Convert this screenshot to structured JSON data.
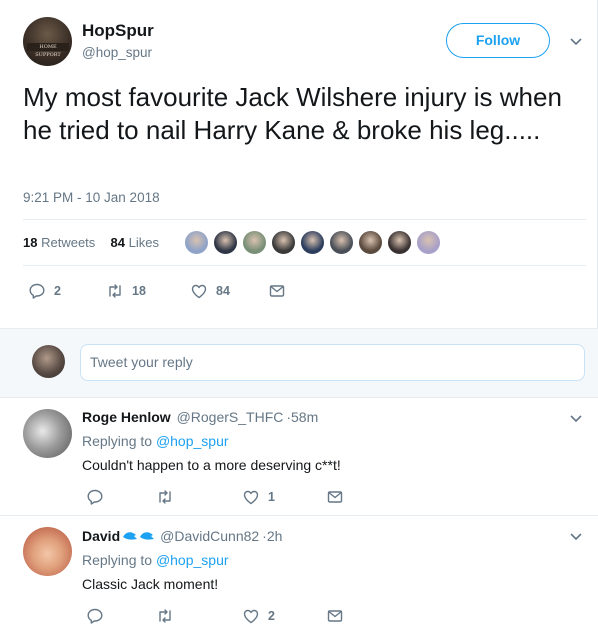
{
  "tweet": {
    "name": "HopSpur",
    "handle": "@hop_spur",
    "follow_label": "Follow",
    "avatar_caption": "HOME SUPPORT",
    "text": "My most favourite Jack Wilshere injury is when he tried to nail Harry Kane & broke his leg.....",
    "timestamp": "9:21 PM - 10 Jan 2018",
    "retweets_count": "18",
    "retweets_label": "Retweets",
    "likes_count": "84",
    "likes_label": "Likes",
    "liker_avatar_colors": [
      "#8fa3c8",
      "#2f3646",
      "#7a8f77",
      "#3a3a3a",
      "#2c3d5e",
      "#4a4f57",
      "#5b4a3e",
      "#3a3232",
      "#a8a0c8"
    ],
    "actions": {
      "replies": "2",
      "retweets": "18",
      "likes": "84"
    }
  },
  "reply_box": {
    "placeholder": "Tweet your reply"
  },
  "replies": [
    {
      "name": "Roge Henlow",
      "handle": "@RogerS_THFC",
      "time": "·58m",
      "replying_to_label": "Replying to",
      "replying_to_handle": "@hop_spur",
      "text": "Couldn't happen to a more deserving c**t!",
      "likes": "1"
    },
    {
      "name": "David",
      "handle": "@DavidCunn82",
      "time": "·2h",
      "replying_to_label": "Replying to",
      "replying_to_handle": "@hop_spur",
      "text": "Classic Jack moment!",
      "likes": "2"
    }
  ],
  "colors": {
    "accent": "#1da1f2",
    "muted": "#657786",
    "text": "#14171a",
    "band": "#f5f8fa"
  }
}
